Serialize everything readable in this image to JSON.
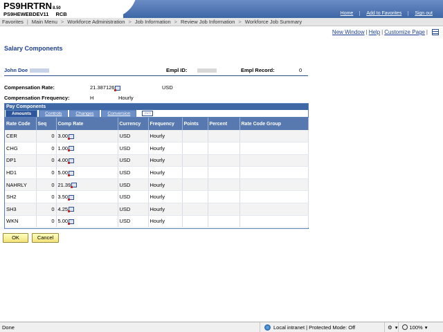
{
  "header": {
    "app_name": "PS9HRTRN",
    "app_version": "8.50",
    "server": "PS9HEWEBDEV11",
    "db": "RCB"
  },
  "top_links": [
    "Home",
    "Add to Favorites",
    "Sign out"
  ],
  "menu": [
    "Favorites",
    "Main Menu",
    "Workforce Administration",
    "Job Information",
    "Review Job Information",
    "Workforce Job Summary"
  ],
  "page_links": {
    "new_window": "New Window",
    "help": "Help",
    "customize": "Customize Page"
  },
  "page_title": "Salary Components",
  "employee": {
    "name": "John Doe",
    "empl_id_label": "Empl ID:",
    "empl_record_label": "Empl Record:",
    "empl_record": "0"
  },
  "compensation": {
    "rate_label": "Compensation Rate:",
    "rate_value": "21.387126",
    "currency": "USD",
    "frequency_label": "Compensation Frequency:",
    "frequency_code": "H",
    "frequency_text": "Hourly"
  },
  "grid": {
    "title": "Pay Components",
    "tabs": [
      "Amounts",
      "Controls",
      "Changes",
      "Conversion"
    ],
    "columns": [
      "Rate Code",
      "Seq",
      "Comp Rate",
      "Currency",
      "Frequency",
      "Points",
      "Percent",
      "Rate Code Group"
    ],
    "rows": [
      {
        "rate_code": "CER",
        "seq": "0",
        "comp_rate": "3.00",
        "currency": "USD",
        "frequency": "Hourly"
      },
      {
        "rate_code": "CHG",
        "seq": "0",
        "comp_rate": "1.00",
        "currency": "USD",
        "frequency": "Hourly"
      },
      {
        "rate_code": "DP1",
        "seq": "0",
        "comp_rate": "4.00",
        "currency": "USD",
        "frequency": "Hourly"
      },
      {
        "rate_code": "HD1",
        "seq": "0",
        "comp_rate": "5.00",
        "currency": "USD",
        "frequency": "Hourly"
      },
      {
        "rate_code": "NAHRLY",
        "seq": "0",
        "comp_rate": "21.39",
        "currency": "USD",
        "frequency": "Hourly"
      },
      {
        "rate_code": "SH2",
        "seq": "0",
        "comp_rate": "3.50",
        "currency": "USD",
        "frequency": "Hourly"
      },
      {
        "rate_code": "SH3",
        "seq": "0",
        "comp_rate": "4.25",
        "currency": "USD",
        "frequency": "Hourly"
      },
      {
        "rate_code": "WKN",
        "seq": "0",
        "comp_rate": "5.00",
        "currency": "USD",
        "frequency": "Hourly"
      }
    ]
  },
  "buttons": {
    "ok": "OK",
    "cancel": "Cancel"
  },
  "status": {
    "text": "Done",
    "zone": "Local intranet | Protected Mode: Off",
    "zoom": "100%"
  },
  "colors": {
    "header_blue": "#3e67a6",
    "link_blue": "#1c3f95",
    "button_yellow": "#f2e27a"
  }
}
